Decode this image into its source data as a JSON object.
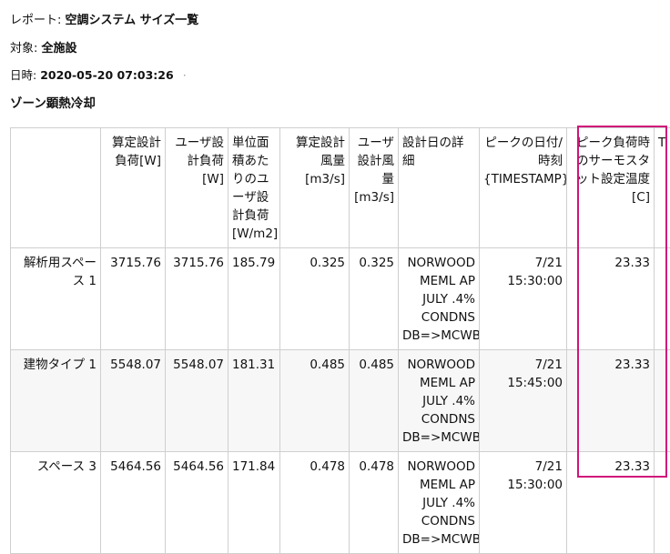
{
  "report": {
    "label": "レポート:",
    "value": "空調システム サイズ一覧"
  },
  "target": {
    "label": "対象:",
    "value": "全施設"
  },
  "timestamp": {
    "label": "日時:",
    "value": "2020-05-20 07:03:26",
    "dot": "·"
  },
  "section_title": "ゾーン顕熱冷却",
  "table": {
    "headers": [
      "",
      "算定設計負荷[W]",
      "ユーザ設計負荷[W]",
      "単位面積あたりのユーザ設計負荷[W/m2]",
      "算定設計風量[m3/s]",
      "ユーザ設計風量[m3/s]",
      "設計日の詳細",
      "ピークの日付/時刻{TIMESTAMP}",
      "ピーク負荷時のサーモスタット設定温度[C]",
      "T"
    ],
    "rows": [
      {
        "name": "解析用スペース 1",
        "calc_load": "3715.76",
        "user_load": "3715.76",
        "per_area": "185.79",
        "calc_flow": "0.325",
        "user_flow": "0.325",
        "design_day": "NORWOOD MEML AP JULY .4% CONDNS DB=>MCWB",
        "peak": "7/21 15:30:00",
        "setpoint": "23.33"
      },
      {
        "name": "建物タイプ 1",
        "calc_load": "5548.07",
        "user_load": "5548.07",
        "per_area": "181.31",
        "calc_flow": "0.485",
        "user_flow": "0.485",
        "design_day": "NORWOOD MEML AP JULY .4% CONDNS DB=>MCWB",
        "peak": "7/21 15:45:00",
        "setpoint": "23.33"
      },
      {
        "name": "スペース 3",
        "calc_load": "5464.56",
        "user_load": "5464.56",
        "per_area": "171.84",
        "calc_flow": "0.478",
        "user_flow": "0.478",
        "design_day": "NORWOOD MEML AP JULY .4% CONDNS DB=>MCWB",
        "peak": "7/21 15:30:00",
        "setpoint": "23.33"
      }
    ]
  },
  "highlight_color": "#d0157a"
}
